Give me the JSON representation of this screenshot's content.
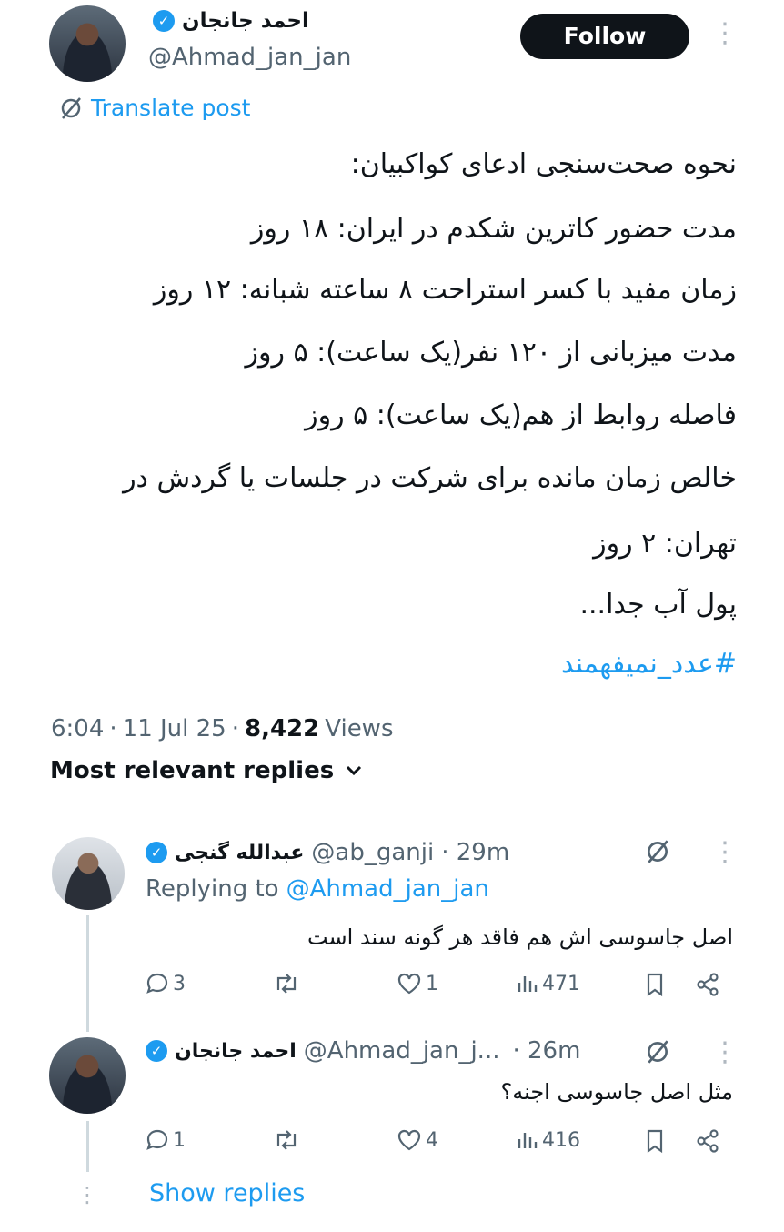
{
  "author": {
    "name": "احمد جانجان",
    "handle": "@Ahmad_jan_jan",
    "verified_icon": "verified-badge-icon"
  },
  "follow_label": "Follow",
  "translate_label": "Translate post",
  "post": {
    "lines": [
      "نحوه صحت‌سنجی ادعای کواکبیان:",
      "مدت حضور کاترین شکدم در ایران: ۱۸ روز",
      "زمان مفید با کسر استراحت ۸ ساعته شبانه: ۱۲ روز",
      "مدت میزبانی از ۱۲۰ نفر(یک ساعت): ۵ روز",
      "فاصله روابط از هم(یک ساعت): ۵ روز",
      "خالص زمان مانده برای شرکت در جلسات یا گردش در",
      "تهران: ۲ روز",
      "پول آب جدا..."
    ],
    "hashtag": "#عدد_نمیفهمند"
  },
  "meta": {
    "time": "6:04",
    "sep1": "·",
    "date": "11 Jul 25",
    "sep2": "·",
    "views_count": "8,422",
    "views_label": "Views"
  },
  "replies_section": {
    "title": "Most relevant replies",
    "chevron_icon": "chevron-down-icon"
  },
  "replies": [
    {
      "name": "عبدالله گنجی",
      "handle": "@ab_ganji",
      "time": "· 29m",
      "replying_prefix": "Replying to",
      "replying_handle": "@Ahmad_jan_jan",
      "text": "اصل جاسوسی اش هم فاقد هر گونه سند است",
      "replies_count": "3",
      "retweets_count": "",
      "likes_count": "1",
      "views_count": "471"
    },
    {
      "name": "احمد جانجان",
      "handle": "@Ahmad_jan_j...",
      "time": "· 26m",
      "text": "مثل اصل جاسوسی اجنه؟",
      "replies_count": "1",
      "retweets_count": "",
      "likes_count": "4",
      "views_count": "416"
    }
  ],
  "show_replies_label": "Show replies",
  "colors": {
    "accent": "#1d9bf0",
    "text": "#0f1419",
    "muted": "#536471",
    "button_bg": "#0f1419"
  }
}
